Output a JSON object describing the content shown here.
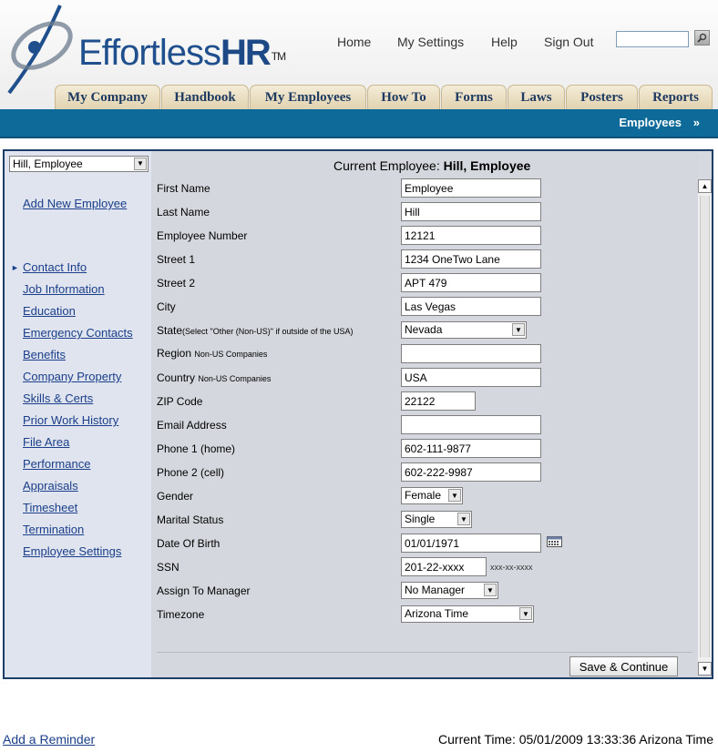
{
  "brand": {
    "name_part1": "Effortless",
    "name_part2": "HR",
    "trademark": "TM"
  },
  "top_nav": {
    "home": "Home",
    "settings": "My Settings",
    "help": "Help",
    "signout": "Sign Out"
  },
  "search": {
    "value": ""
  },
  "tabs": [
    "My Company",
    "Handbook",
    "My Employees",
    "How To",
    "Forms",
    "Laws",
    "Posters",
    "Reports"
  ],
  "subnav": {
    "current": "Employees",
    "arrow": "»"
  },
  "sidebar": {
    "employee_select": "Hill, Employee",
    "add_new": "Add New Employee",
    "active_marker": "►",
    "links": [
      "Contact Info",
      "Job Information",
      "Education",
      "Emergency Contacts",
      "Benefits",
      "Company Property",
      "Skills & Certs",
      "Prior Work History",
      "File Area",
      "Performance",
      "Appraisals",
      "Timesheet",
      "Termination",
      "Employee Settings"
    ]
  },
  "current_employee": {
    "prefix": "Current Employee:",
    "name": "Hill, Employee"
  },
  "form": {
    "first_name": {
      "label": "First Name",
      "value": "Employee"
    },
    "last_name": {
      "label": "Last Name",
      "value": "Hill"
    },
    "employee_number": {
      "label": "Employee Number",
      "value": "12121"
    },
    "street1": {
      "label": "Street 1",
      "value": "1234 OneTwo Lane"
    },
    "street2": {
      "label": "Street 2",
      "value": "APT 479"
    },
    "city": {
      "label": "City",
      "value": "Las Vegas"
    },
    "state": {
      "label": "State",
      "note": "(Select \"Other (Non-US)\" if outside of the USA)",
      "value": "Nevada"
    },
    "region": {
      "label": "Region",
      "note": "Non-US Companies",
      "value": ""
    },
    "country": {
      "label": "Country",
      "note": "Non-US Companies",
      "value": "USA"
    },
    "zip": {
      "label": "ZIP Code",
      "value": "22122"
    },
    "email": {
      "label": "Email Address",
      "value": ""
    },
    "phone1": {
      "label": "Phone 1 (home)",
      "value": "602-111-9877"
    },
    "phone2": {
      "label": "Phone 2 (cell)",
      "value": "602-222-9987"
    },
    "gender": {
      "label": "Gender",
      "value": "Female"
    },
    "marital": {
      "label": "Marital Status",
      "value": "Single"
    },
    "dob": {
      "label": "Date Of Birth",
      "value": "01/01/1971"
    },
    "ssn": {
      "label": "SSN",
      "value": "201-22-xxxx",
      "hint": "xxx-xx-xxxx"
    },
    "manager": {
      "label": "Assign To Manager",
      "value": "No Manager"
    },
    "timezone": {
      "label": "Timezone",
      "value": "Arizona Time"
    }
  },
  "save_button": "Save & Continue",
  "footer": {
    "reminder": "Add a Reminder",
    "current_time": "Current Time: 05/01/2009 13:33:36 Arizona Time"
  }
}
